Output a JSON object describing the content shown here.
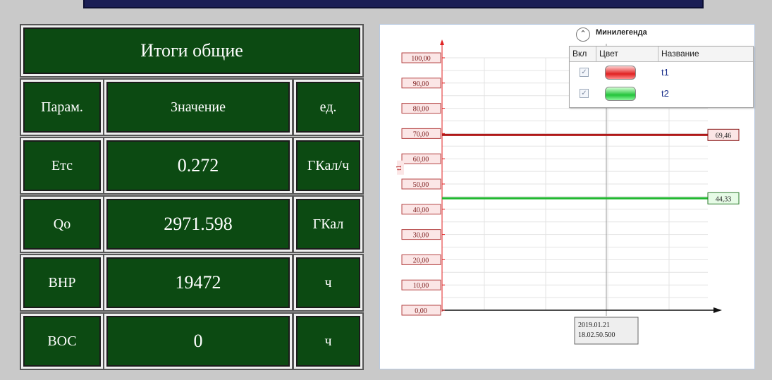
{
  "summary": {
    "title": "Итоги общие",
    "headers": {
      "param": "Парам.",
      "value": "Значение",
      "unit": "ед."
    },
    "rows": [
      {
        "param": "Етс",
        "value": "0.272",
        "unit": "ГКал/ч"
      },
      {
        "param": "Qo",
        "value": "2971.598",
        "unit": "ГКал"
      },
      {
        "param": "ВНР",
        "value": "19472",
        "unit": "ч"
      },
      {
        "param": "ВОС",
        "value": "0",
        "unit": "ч"
      }
    ]
  },
  "minilegend": {
    "title": "Минилегенда",
    "toggle_icon": "chevron-up-icon",
    "columns": {
      "enabled": "Вкл",
      "color": "Цвет",
      "name": "Название"
    },
    "items": [
      {
        "enabled": true,
        "color": "#e02222",
        "name": "t1"
      },
      {
        "enabled": true,
        "color": "#22c43a",
        "name": "t2"
      }
    ]
  },
  "chart_data": {
    "type": "line",
    "y_axis_label": "t1",
    "y_ticks": [
      "100,00",
      "90,00",
      "80,00",
      "70,00",
      "60,00",
      "50,00",
      "40,00",
      "30,00",
      "20,00",
      "10,00",
      "0,00"
    ],
    "ylim": [
      0,
      100
    ],
    "grid": true,
    "x_cursor_label": [
      "2019.01.21",
      "18.02.50.500"
    ],
    "series": [
      {
        "name": "t1",
        "color": "#b01818",
        "value": 69.46,
        "value_label": "69,46"
      },
      {
        "name": "t2",
        "color": "#1fb82e",
        "value": 44.33,
        "value_label": "44,33"
      }
    ]
  }
}
